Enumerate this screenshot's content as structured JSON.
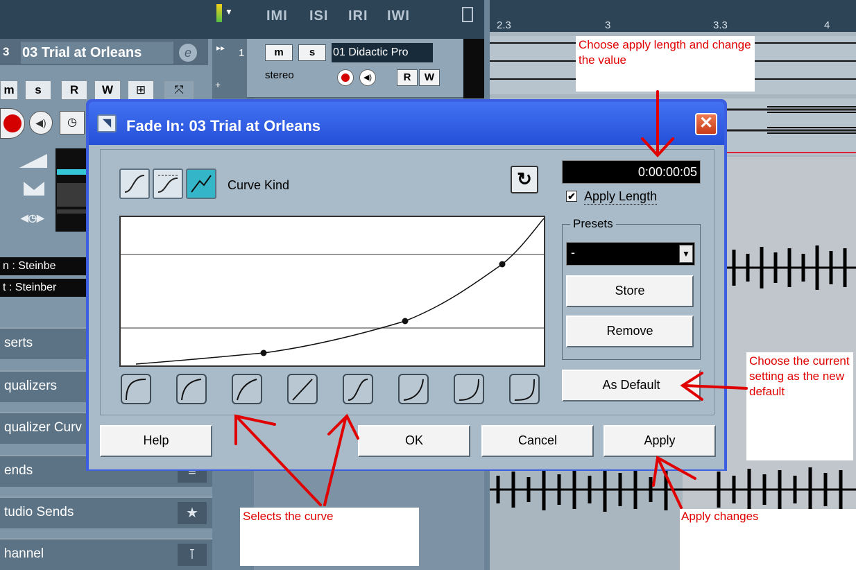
{
  "inspector": {
    "track_number": "3",
    "track_name": "03 Trial at Orleans",
    "e_label": "e",
    "buttons": [
      "m",
      "s",
      "R",
      "W",
      "⊞",
      "⤧"
    ],
    "input_label": "n :  Steinbe",
    "output_label": "t :  Steinber",
    "sections": [
      {
        "label": "serts"
      },
      {
        "label": "qualizers"
      },
      {
        "label": "qualizer Curv"
      },
      {
        "label": "ends"
      },
      {
        "label": "tudio Sends"
      },
      {
        "label": "hannel"
      }
    ]
  },
  "tracklist": {
    "header": [
      "IMI",
      "ISI",
      "IRI",
      "IWI"
    ],
    "track1_number": "1",
    "m_label": "m",
    "s_label": "s",
    "r_label": "R",
    "w_label": "W",
    "track1_name": "01 Didactic Pro",
    "stereo_label": "stereo"
  },
  "ruler": {
    "ticks": [
      "2.3",
      "3",
      "3.3",
      "4"
    ]
  },
  "dialog": {
    "title": "Fade In: 03 Trial at Orleans",
    "close_glyph": "✕",
    "curve_kind_label": "Curve Kind",
    "length_value": "0:00:00:05",
    "apply_length_label": "Apply Length",
    "apply_length_checked": true,
    "presets_label": "Presets",
    "preset_selected": "-",
    "store_label": "Store",
    "remove_label": "Remove",
    "as_default_label": "As Default",
    "help_label": "Help",
    "ok_label": "OK",
    "cancel_label": "Cancel",
    "apply_label": "Apply"
  },
  "annotations": {
    "apply_length_note": "Choose apply length and change the value",
    "default_note": "Choose the current setting as the new default",
    "curve_note": "Selects the curve",
    "apply_note": "Apply changes"
  },
  "colors": {
    "annotation_red": "#e00000",
    "dialog_title_blue": "#2450d8",
    "record_red": "#d40000"
  }
}
